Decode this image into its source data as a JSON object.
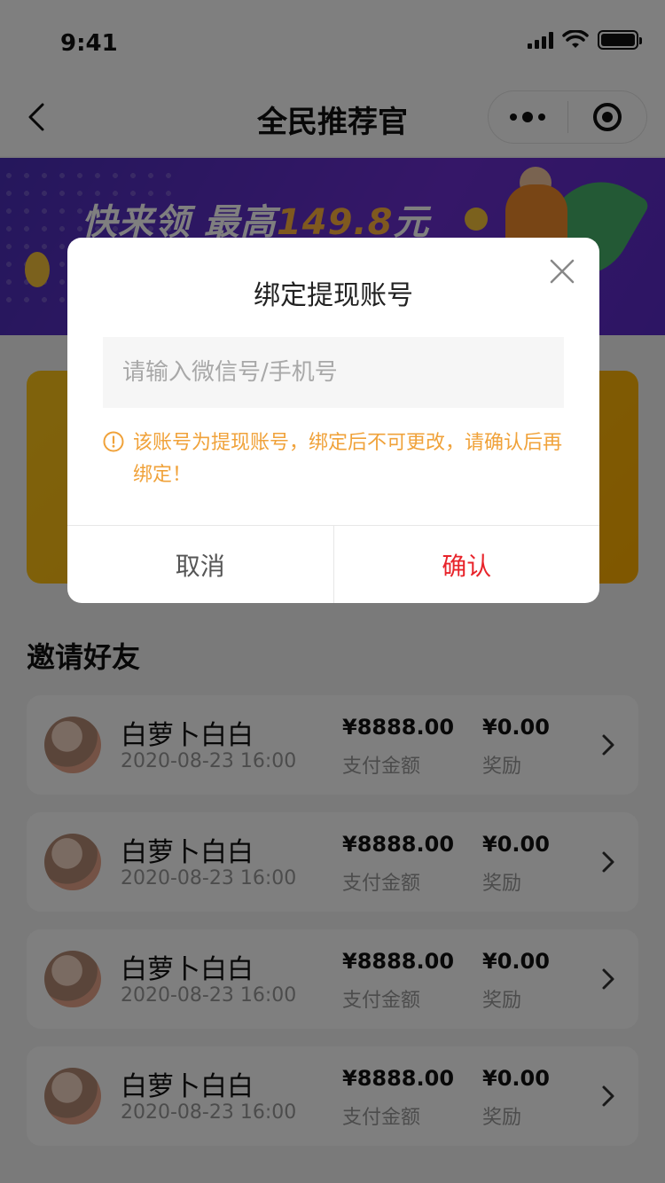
{
  "status_bar": {
    "time": "9:41"
  },
  "nav": {
    "title": "全民推荐官"
  },
  "banner": {
    "text_prefix": "快来领 最高",
    "amount": "149.8",
    "unit": "元"
  },
  "section": {
    "title": "邀请好友"
  },
  "invites": [
    {
      "name": "白萝卜白白",
      "date": "2020-08-23 16:00",
      "amount": "¥8888.00",
      "amount_label": "支付金额",
      "reward": "¥0.00",
      "reward_label": "奖励"
    },
    {
      "name": "白萝卜白白",
      "date": "2020-08-23 16:00",
      "amount": "¥8888.00",
      "amount_label": "支付金额",
      "reward": "¥0.00",
      "reward_label": "奖励"
    },
    {
      "name": "白萝卜白白",
      "date": "2020-08-23 16:00",
      "amount": "¥8888.00",
      "amount_label": "支付金额",
      "reward": "¥0.00",
      "reward_label": "奖励"
    },
    {
      "name": "白萝卜白白",
      "date": "2020-08-23 16:00",
      "amount": "¥8888.00",
      "amount_label": "支付金额",
      "reward": "¥0.00",
      "reward_label": "奖励"
    }
  ],
  "dialog": {
    "title": "绑定提现账号",
    "input_placeholder": "请输入微信号/手机号",
    "input_value": "",
    "warning": "该账号为提现账号，绑定后不可更改，请确认后再绑定！",
    "cancel_label": "取消",
    "confirm_label": "确认"
  },
  "colors": {
    "accent_red": "#e8242b",
    "warning_orange": "#f0a23a",
    "banner_purple": "#5a2ac8"
  },
  "icons": {
    "back": "chevron-left-icon",
    "more": "more-dots-icon",
    "close_mini": "target-icon",
    "dialog_close": "close-icon",
    "warning": "info-circle-icon",
    "row_arrow": "chevron-right-icon"
  }
}
